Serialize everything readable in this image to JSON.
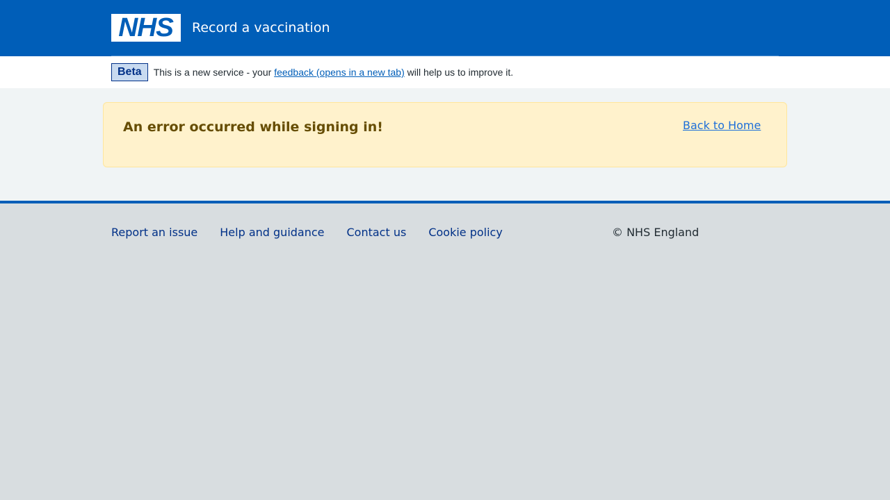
{
  "header": {
    "logo_text": "NHS",
    "service_name": "Record a vaccination"
  },
  "beta_banner": {
    "tag": "Beta",
    "text_before": "This is a new service - your ",
    "link_text": "feedback (opens in a new tab)",
    "text_after": " will help us to improve it."
  },
  "alert": {
    "title": "An error occurred while signing in!",
    "link_text": "Back to Home"
  },
  "footer": {
    "links": [
      "Report an issue",
      "Help and guidance",
      "Contact us",
      "Cookie policy"
    ],
    "copyright": "© NHS England"
  },
  "colors": {
    "header_bg": "#005eb8",
    "alert_bg": "#fff2cc",
    "alert_text": "#664d03",
    "footer_bg": "#d8dde0",
    "link": "#003087"
  }
}
